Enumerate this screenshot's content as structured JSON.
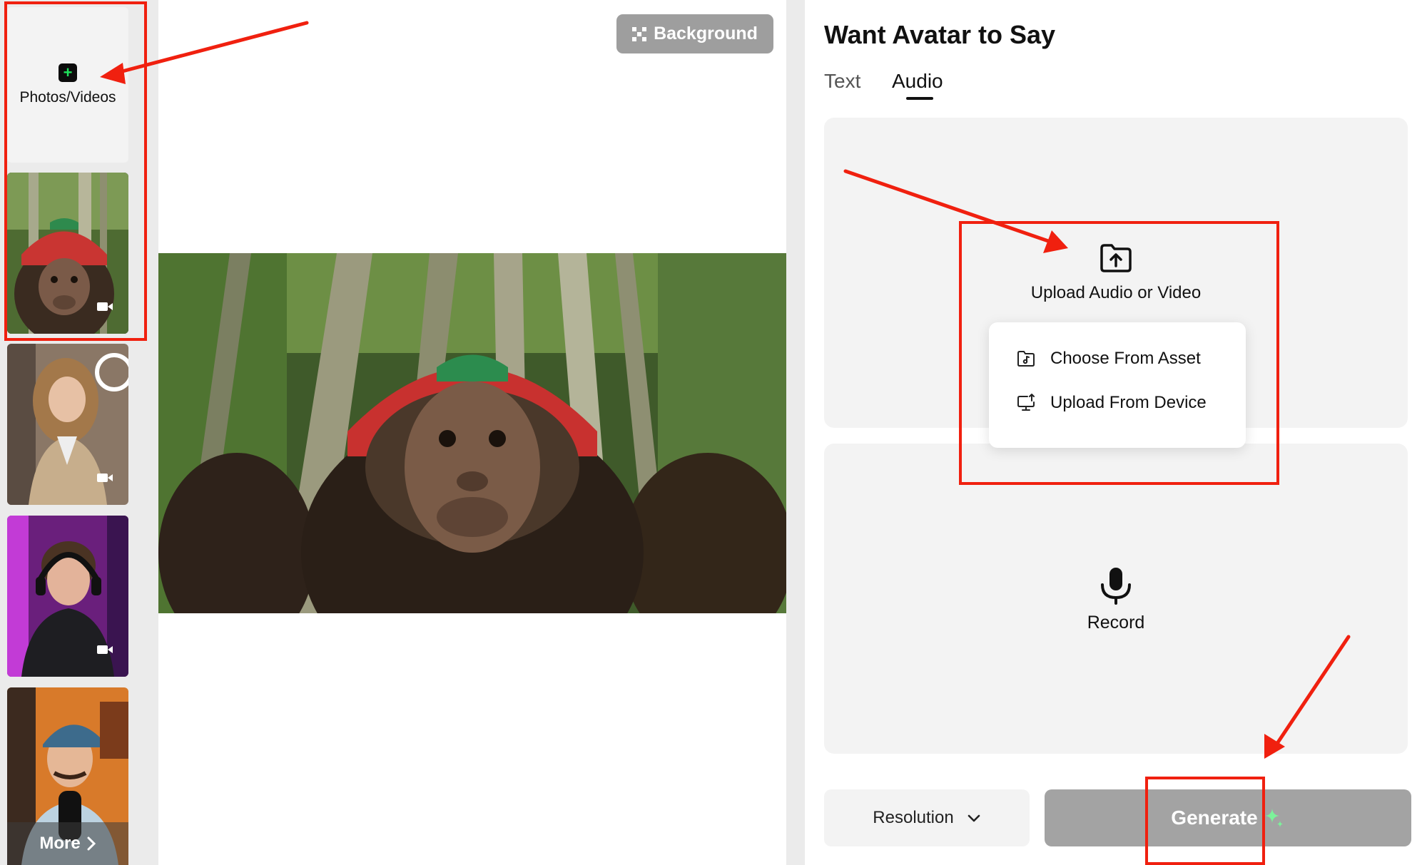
{
  "sidebar": {
    "upload_label": "Photos/Videos",
    "more_label": "More"
  },
  "preview": {
    "background_button_label": "Background"
  },
  "panel": {
    "title": "Want Avatar to Say",
    "tabs": [
      {
        "label": "Text",
        "active": false
      },
      {
        "label": "Audio",
        "active": true
      }
    ],
    "upload_label": "Upload Audio or Video",
    "menu_items": [
      "Choose From Asset",
      "Upload From Device"
    ],
    "record_label": "Record",
    "resolution_label": "Resolution",
    "generate_label": "Generate"
  },
  "colors": {
    "annotation": "#f0200f",
    "generate_disabled": "#a3a3a3",
    "sparkle": "#7cf29a",
    "plus_icon": "#1fe25c"
  }
}
